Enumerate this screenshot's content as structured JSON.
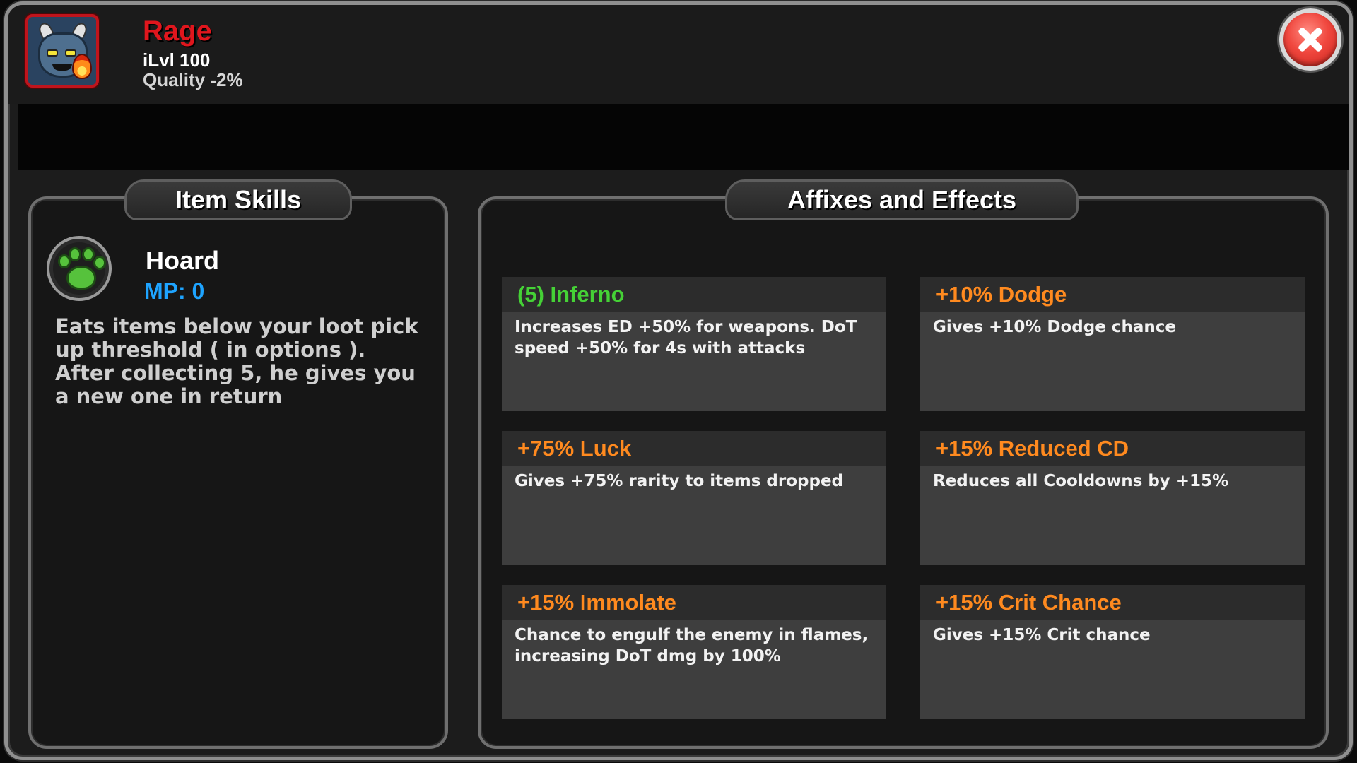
{
  "item": {
    "name": "Rage",
    "level": "iLvl 100",
    "quality": "Quality -2%",
    "icon": "rage-monster-icon"
  },
  "colors": {
    "item_name": "#e0161d",
    "mp": "#1ea4ff",
    "set_affix": "#45d136",
    "affix": "#ff8a1f",
    "close": "#e0352d"
  },
  "close_icon": "close-icon",
  "skills_tab": {
    "title": "Item Skills",
    "skill": {
      "icon": "paw-icon",
      "name": "Hoard",
      "mp": "MP: 0",
      "description": "Eats items below your loot pick up threshold ( in options ). After collecting 5, he gives you a new one in return"
    }
  },
  "affixes_tab": {
    "title": "Affixes and Effects",
    "affixes": [
      {
        "title": "(5) Inferno",
        "description": "Increases ED +50% for  weapons. DoT speed +50% for 4s with  attacks"
      },
      {
        "title": "+10% Dodge",
        "description": "Gives +10% Dodge chance"
      },
      {
        "title": "+75% Luck",
        "description": "Gives +75% rarity to items dropped"
      },
      {
        "title": "+15% Reduced CD",
        "description": "Reduces all Cooldowns by +15%"
      },
      {
        "title": "+15% Immolate",
        "description": "Chance to engulf the enemy in flames, increasing DoT dmg by 100%"
      },
      {
        "title": "+15% Crit Chance",
        "description": "Gives +15% Crit chance"
      }
    ]
  }
}
